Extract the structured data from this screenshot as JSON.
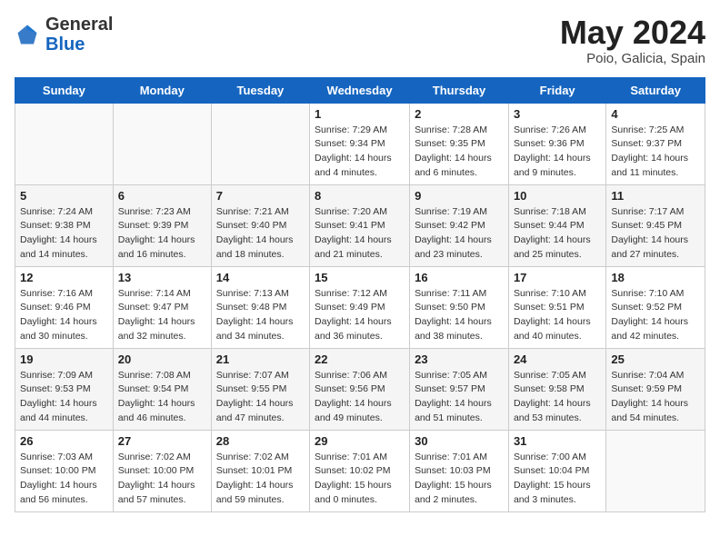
{
  "header": {
    "logo_general": "General",
    "logo_blue": "Blue",
    "month_title": "May 2024",
    "location": "Poio, Galicia, Spain"
  },
  "weekdays": [
    "Sunday",
    "Monday",
    "Tuesday",
    "Wednesday",
    "Thursday",
    "Friday",
    "Saturday"
  ],
  "weeks": [
    [
      {
        "day": "",
        "info": ""
      },
      {
        "day": "",
        "info": ""
      },
      {
        "day": "",
        "info": ""
      },
      {
        "day": "1",
        "info": "Sunrise: 7:29 AM\nSunset: 9:34 PM\nDaylight: 14 hours\nand 4 minutes."
      },
      {
        "day": "2",
        "info": "Sunrise: 7:28 AM\nSunset: 9:35 PM\nDaylight: 14 hours\nand 6 minutes."
      },
      {
        "day": "3",
        "info": "Sunrise: 7:26 AM\nSunset: 9:36 PM\nDaylight: 14 hours\nand 9 minutes."
      },
      {
        "day": "4",
        "info": "Sunrise: 7:25 AM\nSunset: 9:37 PM\nDaylight: 14 hours\nand 11 minutes."
      }
    ],
    [
      {
        "day": "5",
        "info": "Sunrise: 7:24 AM\nSunset: 9:38 PM\nDaylight: 14 hours\nand 14 minutes."
      },
      {
        "day": "6",
        "info": "Sunrise: 7:23 AM\nSunset: 9:39 PM\nDaylight: 14 hours\nand 16 minutes."
      },
      {
        "day": "7",
        "info": "Sunrise: 7:21 AM\nSunset: 9:40 PM\nDaylight: 14 hours\nand 18 minutes."
      },
      {
        "day": "8",
        "info": "Sunrise: 7:20 AM\nSunset: 9:41 PM\nDaylight: 14 hours\nand 21 minutes."
      },
      {
        "day": "9",
        "info": "Sunrise: 7:19 AM\nSunset: 9:42 PM\nDaylight: 14 hours\nand 23 minutes."
      },
      {
        "day": "10",
        "info": "Sunrise: 7:18 AM\nSunset: 9:44 PM\nDaylight: 14 hours\nand 25 minutes."
      },
      {
        "day": "11",
        "info": "Sunrise: 7:17 AM\nSunset: 9:45 PM\nDaylight: 14 hours\nand 27 minutes."
      }
    ],
    [
      {
        "day": "12",
        "info": "Sunrise: 7:16 AM\nSunset: 9:46 PM\nDaylight: 14 hours\nand 30 minutes."
      },
      {
        "day": "13",
        "info": "Sunrise: 7:14 AM\nSunset: 9:47 PM\nDaylight: 14 hours\nand 32 minutes."
      },
      {
        "day": "14",
        "info": "Sunrise: 7:13 AM\nSunset: 9:48 PM\nDaylight: 14 hours\nand 34 minutes."
      },
      {
        "day": "15",
        "info": "Sunrise: 7:12 AM\nSunset: 9:49 PM\nDaylight: 14 hours\nand 36 minutes."
      },
      {
        "day": "16",
        "info": "Sunrise: 7:11 AM\nSunset: 9:50 PM\nDaylight: 14 hours\nand 38 minutes."
      },
      {
        "day": "17",
        "info": "Sunrise: 7:10 AM\nSunset: 9:51 PM\nDaylight: 14 hours\nand 40 minutes."
      },
      {
        "day": "18",
        "info": "Sunrise: 7:10 AM\nSunset: 9:52 PM\nDaylight: 14 hours\nand 42 minutes."
      }
    ],
    [
      {
        "day": "19",
        "info": "Sunrise: 7:09 AM\nSunset: 9:53 PM\nDaylight: 14 hours\nand 44 minutes."
      },
      {
        "day": "20",
        "info": "Sunrise: 7:08 AM\nSunset: 9:54 PM\nDaylight: 14 hours\nand 46 minutes."
      },
      {
        "day": "21",
        "info": "Sunrise: 7:07 AM\nSunset: 9:55 PM\nDaylight: 14 hours\nand 47 minutes."
      },
      {
        "day": "22",
        "info": "Sunrise: 7:06 AM\nSunset: 9:56 PM\nDaylight: 14 hours\nand 49 minutes."
      },
      {
        "day": "23",
        "info": "Sunrise: 7:05 AM\nSunset: 9:57 PM\nDaylight: 14 hours\nand 51 minutes."
      },
      {
        "day": "24",
        "info": "Sunrise: 7:05 AM\nSunset: 9:58 PM\nDaylight: 14 hours\nand 53 minutes."
      },
      {
        "day": "25",
        "info": "Sunrise: 7:04 AM\nSunset: 9:59 PM\nDaylight: 14 hours\nand 54 minutes."
      }
    ],
    [
      {
        "day": "26",
        "info": "Sunrise: 7:03 AM\nSunset: 10:00 PM\nDaylight: 14 hours\nand 56 minutes."
      },
      {
        "day": "27",
        "info": "Sunrise: 7:02 AM\nSunset: 10:00 PM\nDaylight: 14 hours\nand 57 minutes."
      },
      {
        "day": "28",
        "info": "Sunrise: 7:02 AM\nSunset: 10:01 PM\nDaylight: 14 hours\nand 59 minutes."
      },
      {
        "day": "29",
        "info": "Sunrise: 7:01 AM\nSunset: 10:02 PM\nDaylight: 15 hours\nand 0 minutes."
      },
      {
        "day": "30",
        "info": "Sunrise: 7:01 AM\nSunset: 10:03 PM\nDaylight: 15 hours\nand 2 minutes."
      },
      {
        "day": "31",
        "info": "Sunrise: 7:00 AM\nSunset: 10:04 PM\nDaylight: 15 hours\nand 3 minutes."
      },
      {
        "day": "",
        "info": ""
      }
    ]
  ]
}
